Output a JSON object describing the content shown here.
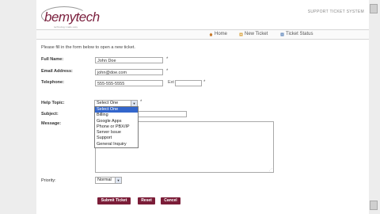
{
  "header": {
    "logo_text": "bemytech",
    "logo_tagline": "technology made easy",
    "system_title": "SUPPORT TICKET SYSTEM"
  },
  "nav": {
    "items": [
      {
        "label": "Home",
        "icon": "home-icon"
      },
      {
        "label": "New Ticket",
        "icon": "new-ticket-icon"
      },
      {
        "label": "Ticket Status",
        "icon": "ticket-status-icon"
      }
    ]
  },
  "form": {
    "intro": "Please fill in the form below to open a new ticket.",
    "full_name": {
      "label": "Full Name:",
      "value": "John Doe",
      "required_mark": "*"
    },
    "email": {
      "label": "Email Address:",
      "value": "john@doe.com",
      "required_mark": "*"
    },
    "telephone": {
      "label": "Telephone:",
      "value": "555-555-5555",
      "ext_label": "Ext",
      "ext_value": "",
      "required_mark": "*"
    },
    "help_topic": {
      "label": "Help Topic:",
      "selected": "Select One",
      "required_mark": "*",
      "options": [
        "Select One",
        "Billing",
        "Google Apps",
        "Phone or PBX/IP",
        "Server Issue",
        "Support",
        "General Inquiry"
      ]
    },
    "subject": {
      "label": "Subject:",
      "value": ""
    },
    "message": {
      "label": "Message:",
      "value": ""
    },
    "priority": {
      "label": "Priority:",
      "selected": "Normal"
    }
  },
  "buttons": {
    "submit": "Submit Ticket",
    "reset": "Reset",
    "cancel": "Cancel"
  },
  "colors": {
    "brand": "#7b1d38",
    "dropdown_highlight": "#3366cc"
  }
}
